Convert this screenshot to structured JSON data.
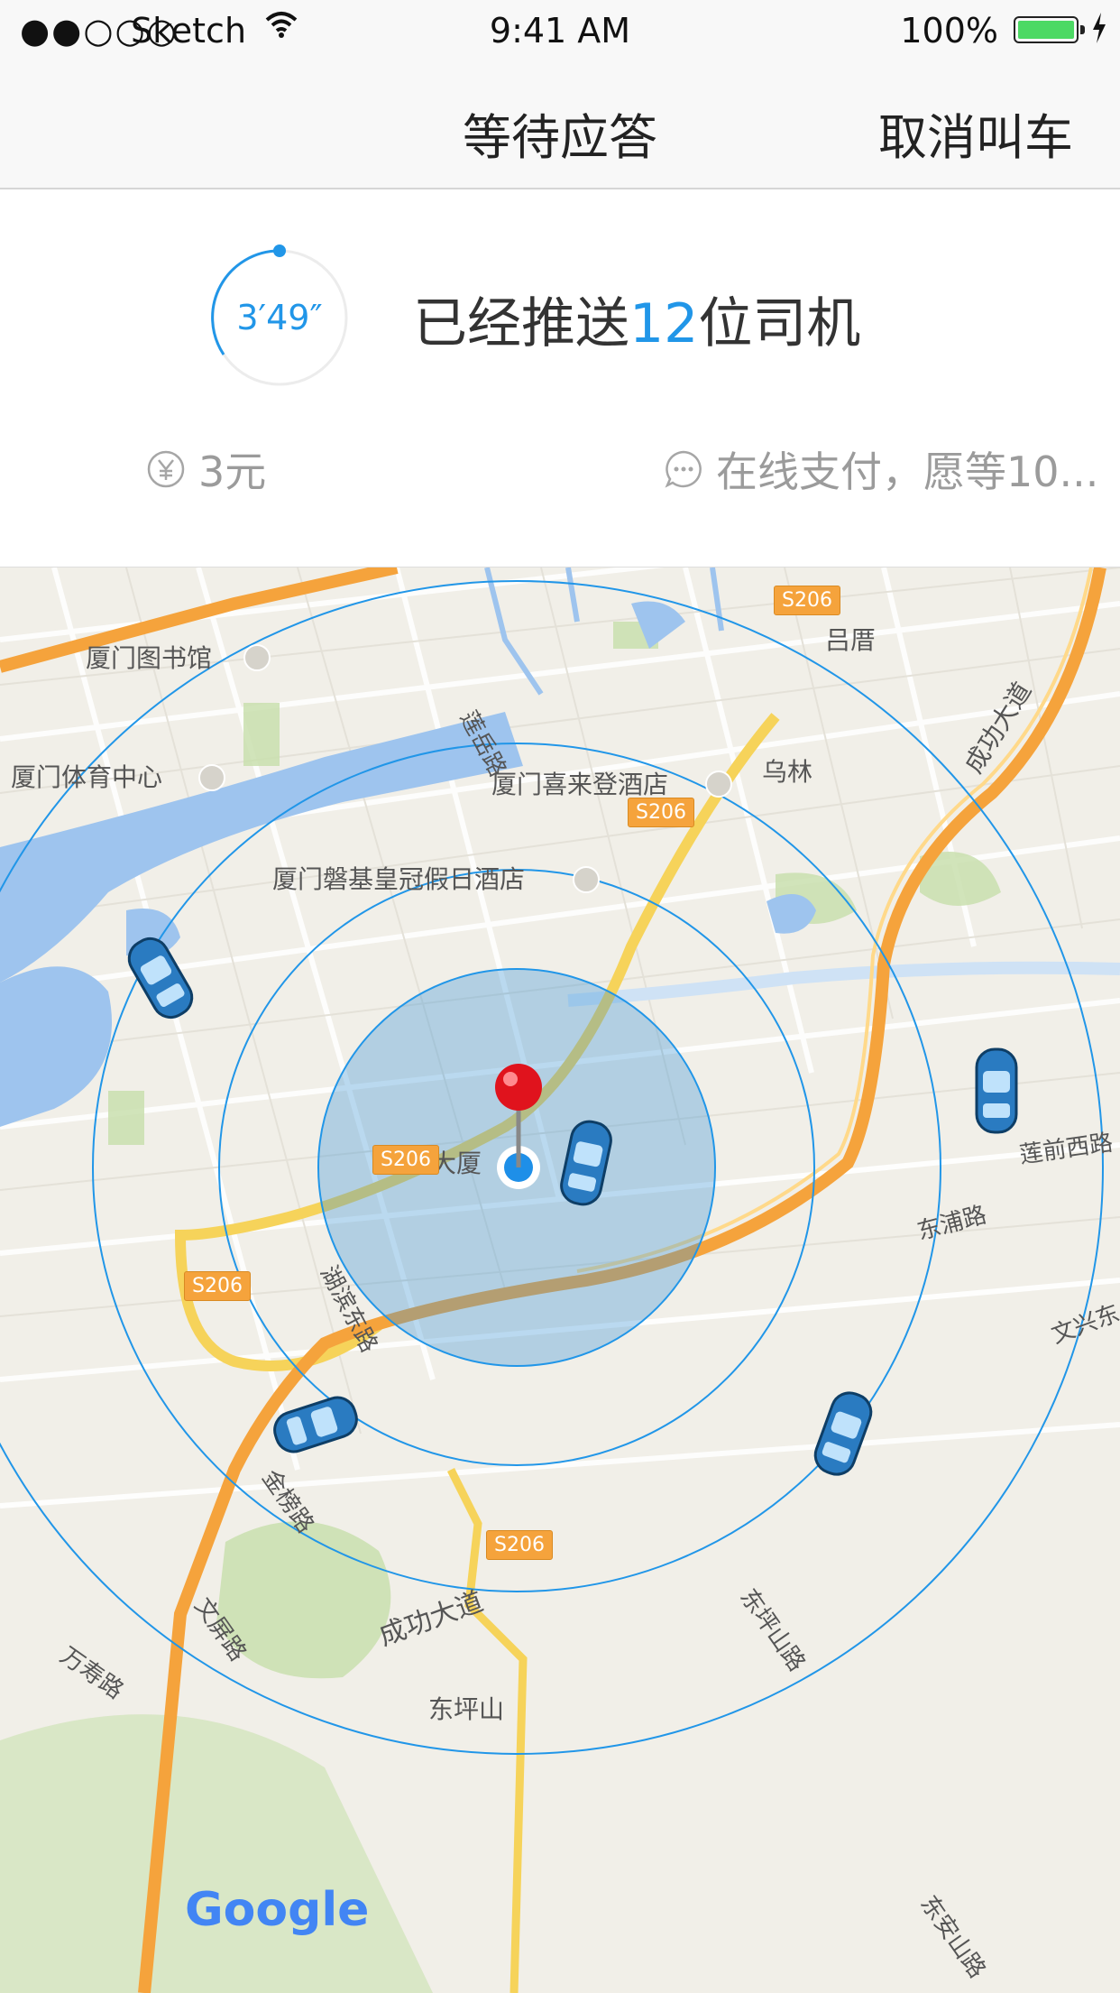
{
  "status_bar": {
    "signal": "●●○○○",
    "carrier": "Sketch",
    "time": "9:41 AM",
    "battery_percent": "100%"
  },
  "nav": {
    "title": "等待应答",
    "cancel_label": "取消叫车"
  },
  "info": {
    "timer": "3′49″",
    "pushed_prefix": "已经推送",
    "pushed_count": "12",
    "pushed_suffix": "位司机",
    "price": "3元",
    "payment_note": "在线支付，愿等10..."
  },
  "map": {
    "labels": {
      "library": "厦门图书馆",
      "sports": "厦门体育中心",
      "sheraton": "厦门喜来登酒店",
      "holiday_inn": "厦门磐基皇冠假日酒店",
      "guomao": "国贸大厦",
      "lu_cuo": "吕厝",
      "wu_lin": "乌林",
      "lianyue": "莲岳路",
      "hubin_east": "湖滨东路",
      "jinbang": "金榜路",
      "wenping": "文屏路",
      "wanshou": "万寿路",
      "chenggong1": "成功大道",
      "chenggong2": "成功大道",
      "dongping_shan": "东坪山",
      "dongping_road": "东坪山路",
      "dongpu": "东浦路",
      "lianqian": "莲前西路",
      "wenxing": "文兴东",
      "dongsha": "东安山路",
      "google": "Google"
    },
    "road_badges": [
      "S206",
      "S206",
      "S206",
      "S206",
      "S206"
    ],
    "colors": {
      "accent": "#2196e8",
      "highway": "#f5a33c",
      "water": "#9ec4ee",
      "land": "#f1efe8",
      "park": "#c9dfae"
    }
  }
}
